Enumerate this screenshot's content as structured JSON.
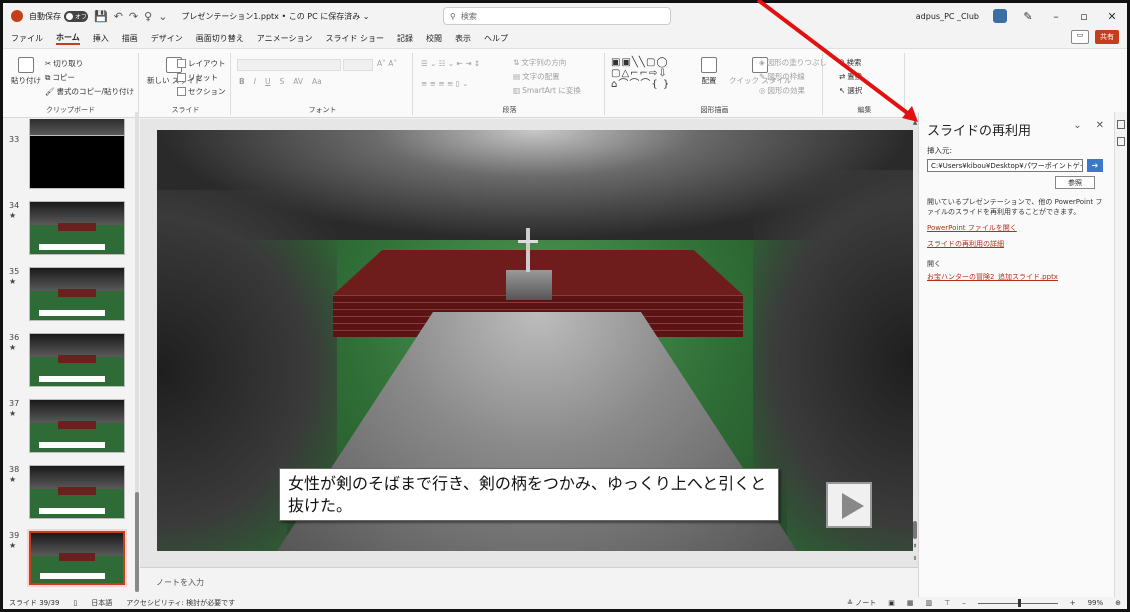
{
  "titlebar": {
    "autosave_label": "自動保存",
    "autosave_state": "オフ",
    "doc_title": "プレゼンテーション1.pptx • この PC に保存済み ⌄",
    "search_placeholder": "検索",
    "user_name": "adpus_PC _Club"
  },
  "menu": {
    "tabs": [
      "ファイル",
      "ホーム",
      "挿入",
      "描画",
      "デザイン",
      "画面切り替え",
      "アニメーション",
      "スライド ショー",
      "記録",
      "校閲",
      "表示",
      "ヘルプ"
    ],
    "active_tab": "ホーム",
    "share_label": "共有"
  },
  "ribbon": {
    "clipboard": {
      "label": "クリップボード",
      "paste": "貼り付け",
      "cut": "切り取り",
      "copy": "コピー",
      "format_painter": "書式のコピー/貼り付け"
    },
    "slides": {
      "label": "スライド",
      "new_slide": "新しい\nスライド",
      "layout": "レイアウト",
      "reset": "リセット",
      "section": "セクション"
    },
    "font": {
      "label": "フォント",
      "bold": "B",
      "italic": "I",
      "underline": "U",
      "strike": "S",
      "spacing": "AV",
      "case": "Aa"
    },
    "paragraph": {
      "label": "段落",
      "text_direction": "文字列の方向",
      "align_text": "文字の配置",
      "smartart": "SmartArt に変換"
    },
    "drawing": {
      "label": "図形描画",
      "arrange": "配置",
      "quick_styles": "クイック\nスタイル",
      "shape_fill": "図形の塗りつぶし",
      "shape_outline": "図形の枠線",
      "shape_effects": "図形の効果"
    },
    "editing": {
      "label": "編集",
      "find": "検索",
      "replace": "置換",
      "select": "選択"
    }
  },
  "thumbnails": [
    {
      "num": "33",
      "star": "",
      "kind": "black"
    },
    {
      "num": "34",
      "star": "★",
      "kind": "scene"
    },
    {
      "num": "35",
      "star": "★",
      "kind": "scene"
    },
    {
      "num": "36",
      "star": "★",
      "kind": "scene"
    },
    {
      "num": "37",
      "star": "★",
      "kind": "scene"
    },
    {
      "num": "38",
      "star": "★",
      "kind": "scene"
    },
    {
      "num": "39",
      "star": "★",
      "kind": "scene",
      "selected": true
    }
  ],
  "slide": {
    "caption": "女性が剣のそばまで行き、剣の柄をつかみ、ゆっくり上へと引くと抜けた。"
  },
  "notes": {
    "placeholder": "ノートを入力"
  },
  "reuse_pane": {
    "title": "スライドの再利用",
    "insert_from_label": "挿入元:",
    "path_value": "C:¥Users¥kibou¥Desktop¥パワーポイントゲー",
    "browse_label": "参照",
    "description": "開いているプレゼンテーションで、他の PowerPoint ファイルのスライドを再利用することができます。",
    "link_open_file": "PowerPoint ファイルを開く",
    "link_details": "スライドの再利用の詳細",
    "open_label": "開く",
    "recent_file": "お宝ハンターの冒険2_追加スライド.pptx"
  },
  "status": {
    "slide_counter": "スライド 39/39",
    "language": "日本語",
    "accessibility": "アクセシビリティ: 検討が必要です",
    "notes_btn": "ノート",
    "zoom": "99%"
  },
  "colors": {
    "accent": "#c43e1c",
    "annotation_arrow": "#e31010",
    "link": "#b52f1a"
  }
}
